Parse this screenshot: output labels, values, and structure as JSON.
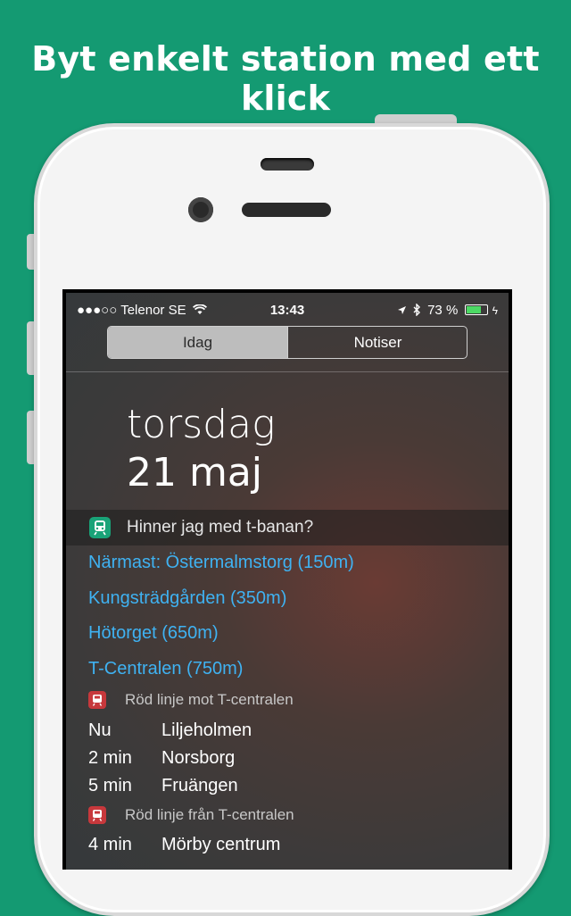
{
  "headline": "Byt enkelt station med ett klick",
  "statusbar": {
    "signal": "●●●○○",
    "carrier": "Telenor SE",
    "wifi_icon": "wifi-icon",
    "time": "13:43",
    "location_icon": "location-arrow-icon",
    "bluetooth_icon": "bluetooth-icon",
    "battery_text": "73 %",
    "battery_level": 0.73
  },
  "tabs": {
    "today": "Idag",
    "notifications": "Notiser"
  },
  "date": {
    "weekday": "torsdag",
    "day": "21 maj"
  },
  "widget": {
    "title": "Hinner jag med t-banan?",
    "icon": "train-icon",
    "accent": "#19a378",
    "stations": [
      "Närmast: Östermalmstorg (150m)",
      "Kungsträdgården (350m)",
      "Hötorget (650m)",
      "T-Centralen (750m)"
    ],
    "lines": [
      {
        "title": "Röd linje mot T-centralen",
        "color": "#c7383c",
        "departures": [
          {
            "time": "Nu",
            "destination": "Liljeholmen"
          },
          {
            "time": "2 min",
            "destination": "Norsborg"
          },
          {
            "time": "5 min",
            "destination": "Fruängen"
          }
        ]
      },
      {
        "title": "Röd linje från T-centralen",
        "color": "#c7383c",
        "departures": [
          {
            "time": "4 min",
            "destination": "Mörby centrum"
          }
        ]
      }
    ]
  }
}
